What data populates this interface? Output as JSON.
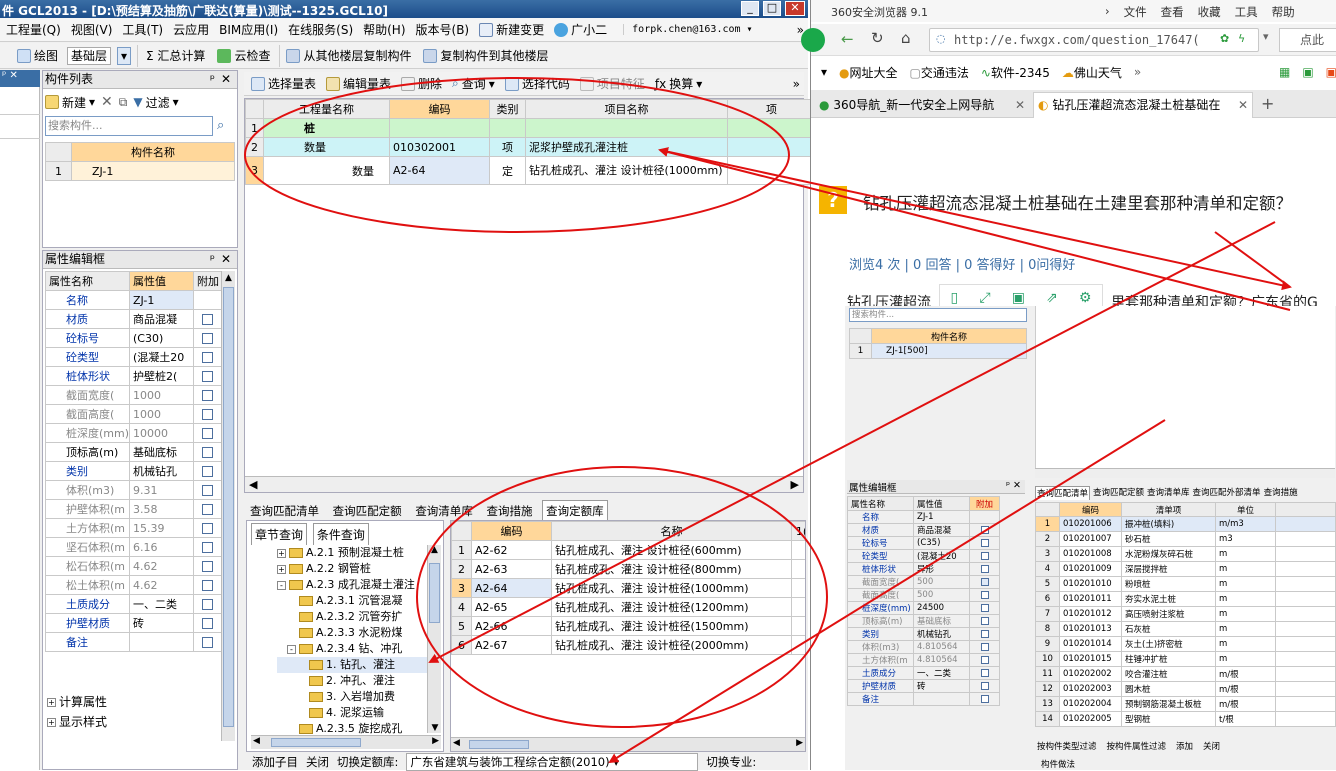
{
  "gcl": {
    "title": "件 GCL2013 - [D:\\预结算及抽筋\\广联达(算量)\\测试--1325.GCL10]",
    "menu": [
      "工程量(Q)",
      "视图(V)",
      "工具(T)",
      "云应用",
      "BIM应用(I)",
      "在线服务(S)",
      "帮助(H)",
      "版本号(B)",
      "新建变更",
      "广小二"
    ],
    "account": "forpk.chen@163.com",
    "toolbar2": {
      "draw": "绘图",
      "layer": "基础层",
      "sum": "Σ 汇总计算",
      "cloud_check": "云检查",
      "copy_from": "从其他楼层复制构件",
      "copy_to": "复制构件到其他楼层"
    },
    "comp_list": {
      "title": "构件列表",
      "new": "新建",
      "filter": "过滤",
      "search_placeholder": "搜索构件...",
      "col": "构件名称",
      "rows": [
        {
          "n": "1",
          "name": "ZJ-1"
        }
      ]
    },
    "props": {
      "title": "属性编辑框",
      "cols": [
        "属性名称",
        "属性值",
        "附加"
      ],
      "rows": [
        {
          "n": "名称",
          "v": "ZJ-1",
          "blue": true,
          "cb": false,
          "hasCb": false
        },
        {
          "n": "材质",
          "v": "商品混凝",
          "blue": true,
          "cb": false,
          "hasCb": true
        },
        {
          "n": "砼标号",
          "v": "(C30)",
          "blue": true,
          "cb": false,
          "hasCb": true
        },
        {
          "n": "砼类型",
          "v": "(混凝土20",
          "blue": true,
          "cb": false,
          "hasCb": true
        },
        {
          "n": "桩体形状",
          "v": "护壁桩2(",
          "blue": true,
          "cb": false,
          "hasCb": true
        },
        {
          "n": "截面宽度(",
          "v": "1000",
          "blue": false,
          "cb": false,
          "hasCb": true
        },
        {
          "n": "截面高度(",
          "v": "1000",
          "blue": false,
          "cb": false,
          "hasCb": true
        },
        {
          "n": "桩深度(mm)",
          "v": "10000",
          "blue": false,
          "cb": false,
          "hasCb": true
        },
        {
          "n": "顶标高(m)",
          "v": "基础底标",
          "blue": false,
          "cb": false,
          "hasCb": true,
          "dark": true
        },
        {
          "n": "类别",
          "v": "机械钻孔",
          "blue": true,
          "cb": false,
          "hasCb": true
        },
        {
          "n": "体积(m3)",
          "v": "9.31",
          "blue": false,
          "cb": false,
          "hasCb": true
        },
        {
          "n": "护壁体积(m",
          "v": "3.58",
          "blue": false,
          "cb": false,
          "hasCb": true
        },
        {
          "n": "土方体积(m",
          "v": "15.39",
          "blue": false,
          "cb": false,
          "hasCb": true
        },
        {
          "n": "坚石体积(m",
          "v": "6.16",
          "blue": false,
          "cb": false,
          "hasCb": true
        },
        {
          "n": "松石体积(m",
          "v": "4.62",
          "blue": false,
          "cb": false,
          "hasCb": true
        },
        {
          "n": "松土体积(m",
          "v": "4.62",
          "blue": false,
          "cb": false,
          "hasCb": true
        },
        {
          "n": "土质成分",
          "v": "一、二类",
          "blue": true,
          "cb": false,
          "hasCb": true
        },
        {
          "n": "护壁材质",
          "v": "砖",
          "blue": true,
          "cb": false,
          "hasCb": true
        },
        {
          "n": "备注",
          "v": "",
          "blue": true,
          "cb": false,
          "hasCb": true
        }
      ],
      "expanders": [
        "计算属性",
        "显示样式"
      ]
    },
    "main_toolbar": [
      "选择量表",
      "编辑量表",
      "删除",
      "查询",
      "选择代码",
      "项目特征",
      "换算"
    ],
    "qty_table": {
      "cols": [
        "工程量名称",
        "编码",
        "类别",
        "项目名称",
        "项"
      ],
      "rows": [
        {
          "n": "1",
          "name": "桩",
          "code": "",
          "type": "",
          "proj": ""
        },
        {
          "n": "2",
          "name": "数量",
          "code": "010302001",
          "type": "项",
          "proj": "泥浆护壁成孔灌注桩"
        },
        {
          "n": "3",
          "name": "数量",
          "code": "A2-64",
          "type": "定",
          "proj": "钻孔桩成孔、灌注 设计桩径(1000mm)"
        }
      ]
    },
    "query_tabs": [
      "查询匹配清单",
      "查询匹配定额",
      "查询清单库",
      "查询措施",
      "查询定额库"
    ],
    "sub_tabs": [
      "章节查询",
      "条件查询"
    ],
    "tree": [
      {
        "lv": 1,
        "pm": "+",
        "t": "A.2.1 预制混凝土桩"
      },
      {
        "lv": 1,
        "pm": "+",
        "t": "A.2.2 钢管桩"
      },
      {
        "lv": 1,
        "pm": "-",
        "t": "A.2.3 成孔混凝土灌注"
      },
      {
        "lv": 2,
        "pm": "",
        "t": "A.2.3.1 沉管混凝"
      },
      {
        "lv": 2,
        "pm": "",
        "t": "A.2.3.2 沉管夯扩"
      },
      {
        "lv": 2,
        "pm": "",
        "t": "A.2.3.3 水泥粉煤"
      },
      {
        "lv": 2,
        "pm": "-",
        "t": "A.2.3.4 钻、冲孔"
      },
      {
        "lv": 3,
        "pm": "",
        "t": "1. 钻孔、灌注"
      },
      {
        "lv": 3,
        "pm": "",
        "t": "2. 冲孔、灌注"
      },
      {
        "lv": 3,
        "pm": "",
        "t": "3. 入岩增加费"
      },
      {
        "lv": 3,
        "pm": "",
        "t": "4. 泥浆运输"
      },
      {
        "lv": 2,
        "pm": "",
        "t": "A.2.3.5 旋挖成孔"
      }
    ],
    "quota_table": {
      "cols": [
        "编码",
        "名称",
        "1("
      ],
      "rows": [
        {
          "n": "1",
          "code": "A2-62",
          "name": "钻孔桩成孔、灌注 设计桩径(600mm)"
        },
        {
          "n": "2",
          "code": "A2-63",
          "name": "钻孔桩成孔、灌注 设计桩径(800mm)"
        },
        {
          "n": "3",
          "code": "A2-64",
          "name": "钻孔桩成孔、灌注 设计桩径(1000mm)"
        },
        {
          "n": "4",
          "code": "A2-65",
          "name": "钻孔桩成孔、灌注 设计桩径(1200mm)"
        },
        {
          "n": "5",
          "code": "A2-66",
          "name": "钻孔桩成孔、灌注 设计桩径(1500mm)"
        },
        {
          "n": "6",
          "code": "A2-67",
          "name": "钻孔桩成孔、灌注 设计桩径(2000mm)"
        }
      ]
    },
    "bottom_bar": {
      "add": "添加子目",
      "close": "关闭",
      "switch_lib": "切换定额库:",
      "lib": "广东省建筑与装饰工程综合定额(2010)",
      "switch_major": "切换专业:"
    }
  },
  "browser": {
    "app_title": "360安全浏览器 9.1",
    "menu": [
      "文件",
      "查看",
      "收藏",
      "工具",
      "帮助"
    ],
    "url": "http://e.fwxgx.com/question_17647(",
    "addr_right": "点此",
    "bookmarks": [
      "网址大全",
      "交通违法",
      "软件-2345",
      "佛山天气"
    ],
    "tabs": [
      {
        "t": "360导航_新一代安全上网导航"
      },
      {
        "t": "钻孔压灌超流态混凝土桩基础在"
      }
    ],
    "question": "钻孔压灌超流态混凝土桩基础在土建里套那种清单和定额？",
    "stats": "浏览4 次 | 0 回答 | 0 答得好 | 0问得好",
    "body_start": "钻孔压灌超流",
    "body_end": "里套那种清单和定额？广东省的G",
    "shot": {
      "search_placeholder": "搜索构件...",
      "col": "构件名称",
      "row": {
        "n": "1",
        "name": "ZJ-1[500]"
      },
      "props_title": "属性编辑框",
      "props_cols": [
        "属性名称",
        "属性值",
        "附加"
      ],
      "props": [
        {
          "n": "名称",
          "v": "ZJ-1",
          "b": true
        },
        {
          "n": "材质",
          "v": "商品混凝",
          "b": true
        },
        {
          "n": "砼标号",
          "v": "(C35)",
          "b": true
        },
        {
          "n": "砼类型",
          "v": "(混凝土20",
          "b": true
        },
        {
          "n": "桩体形状",
          "v": "异形",
          "b": true
        },
        {
          "n": "截面宽度(",
          "v": "500",
          "b": false,
          "on": true
        },
        {
          "n": "截面高度(",
          "v": "500",
          "b": false
        },
        {
          "n": "桩深度(mm)",
          "v": "24500",
          "b": true
        },
        {
          "n": "顶标高(m)",
          "v": "基础底标",
          "b": false
        },
        {
          "n": "类别",
          "v": "机械钻孔",
          "b": true
        },
        {
          "n": "体积(m3)",
          "v": "4.810564",
          "b": false
        },
        {
          "n": "土方体积(m",
          "v": "4.810564",
          "b": false
        },
        {
          "n": "土质成分",
          "v": "一、二类",
          "b": true
        },
        {
          "n": "护壁材质",
          "v": "砖",
          "b": true
        },
        {
          "n": "备注",
          "v": "",
          "b": true
        }
      ],
      "qtabs": [
        "查询匹配清单",
        "查询匹配定额",
        "查询清单库",
        "查询匹配外部清单",
        "查询措施"
      ],
      "list_cols": [
        "编码",
        "清单项",
        "单位"
      ],
      "list": [
        {
          "n": "1",
          "c": "010201006",
          "t": "振冲桩(填料)",
          "u": "m/m3"
        },
        {
          "n": "2",
          "c": "010201007",
          "t": "砂石桩",
          "u": "m3"
        },
        {
          "n": "3",
          "c": "010201008",
          "t": "水泥粉煤灰碎石桩",
          "u": "m"
        },
        {
          "n": "4",
          "c": "010201009",
          "t": "深层搅拌桩",
          "u": "m"
        },
        {
          "n": "5",
          "c": "010201010",
          "t": "粉喷桩",
          "u": "m"
        },
        {
          "n": "6",
          "c": "010201011",
          "t": "夯实水泥土桩",
          "u": "m"
        },
        {
          "n": "7",
          "c": "010201012",
          "t": "高压喷射注浆桩",
          "u": "m"
        },
        {
          "n": "8",
          "c": "010201013",
          "t": "石灰桩",
          "u": "m"
        },
        {
          "n": "9",
          "c": "010201014",
          "t": "灰土(土)挤密桩",
          "u": "m"
        },
        {
          "n": "10",
          "c": "010201015",
          "t": "柱锤冲扩桩",
          "u": "m"
        },
        {
          "n": "11",
          "c": "010202002",
          "t": "咬合灌注桩",
          "u": "m/根"
        },
        {
          "n": "12",
          "c": "010202003",
          "t": "圆木桩",
          "u": "m/根"
        },
        {
          "n": "13",
          "c": "010202004",
          "t": "预制钢筋混凝土板桩",
          "u": "m/根"
        },
        {
          "n": "14",
          "c": "010202005",
          "t": "型钢桩",
          "u": "t/根"
        }
      ],
      "filter1": "按构件类型过滤",
      "filter2": "按构件属性过滤",
      "add": "添加",
      "close": "关闭",
      "bottom_tab": "构件做法"
    }
  }
}
